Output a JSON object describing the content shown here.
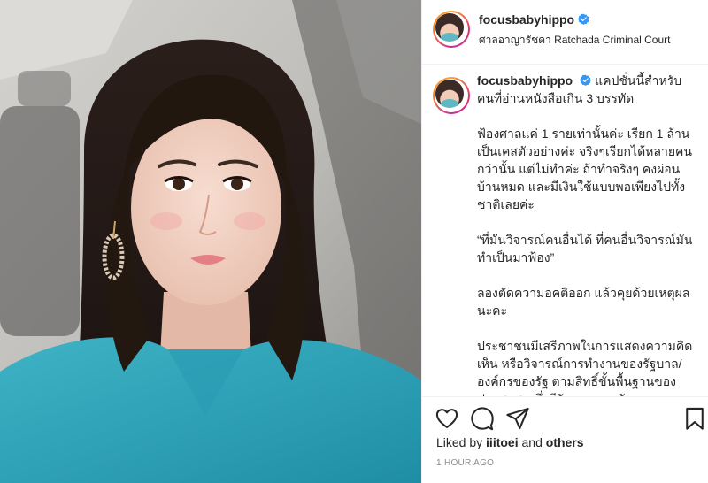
{
  "post": {
    "username": "focusbabyhippo",
    "verified": true,
    "location": "ศาลอาญารัชดา Ratchada Criminal Court",
    "caption": "แคปชั่นนี้สำหรับคนที่อ่านหนังสือเกิน 3 บรรทัด\n\nฟ้องศาลแค่ 1 รายเท่านั้นค่ะ เรียก 1 ล้าน เป็นเคสตัวอย่างค่ะ จริงๆเรียกได้หลายคนกว่านั้น แต่ไม่ทำค่ะ ถ้าทำจริงๆ คงผ่อนบ้านหมด และมีเงินใช้แบบพอเพียงไปทั้งชาติเลยค่ะ\n\n“ที่มันวิจารณ์คนอื่นได้ ที่คนอื่นวิจารณ์มันทำเป็นมาฟ้อง”\n\nลองตัดความอคติออก แล้วคุยด้วยเหตุผลนะคะ\n\nประชาชนมีเสรีภาพในการแสดงความคิดเห็น หรือวิจารณ์การทำงานของรัฐบาล/องค์กรของรัฐ ตามสิทธิ์ขั้นพื้นฐานของประชาชน ซึ่งมีรัฐธรรมนูญรับรองและคุ้มครองอยู่นะคะ",
    "liked_by_prefix": "Liked by",
    "liked_by_user": "iiitoei",
    "liked_by_and": "and",
    "liked_by_others": "others",
    "timestamp": "1 HOUR AGO"
  },
  "icons": {
    "like": "heart-icon",
    "comment": "comment-icon",
    "share": "share-icon",
    "save": "bookmark-icon",
    "verified": "verified-badge-icon"
  },
  "colors": {
    "verified": "#3897f0",
    "muted": "#8e8e8e",
    "text": "#262626",
    "border": "#efefef"
  }
}
